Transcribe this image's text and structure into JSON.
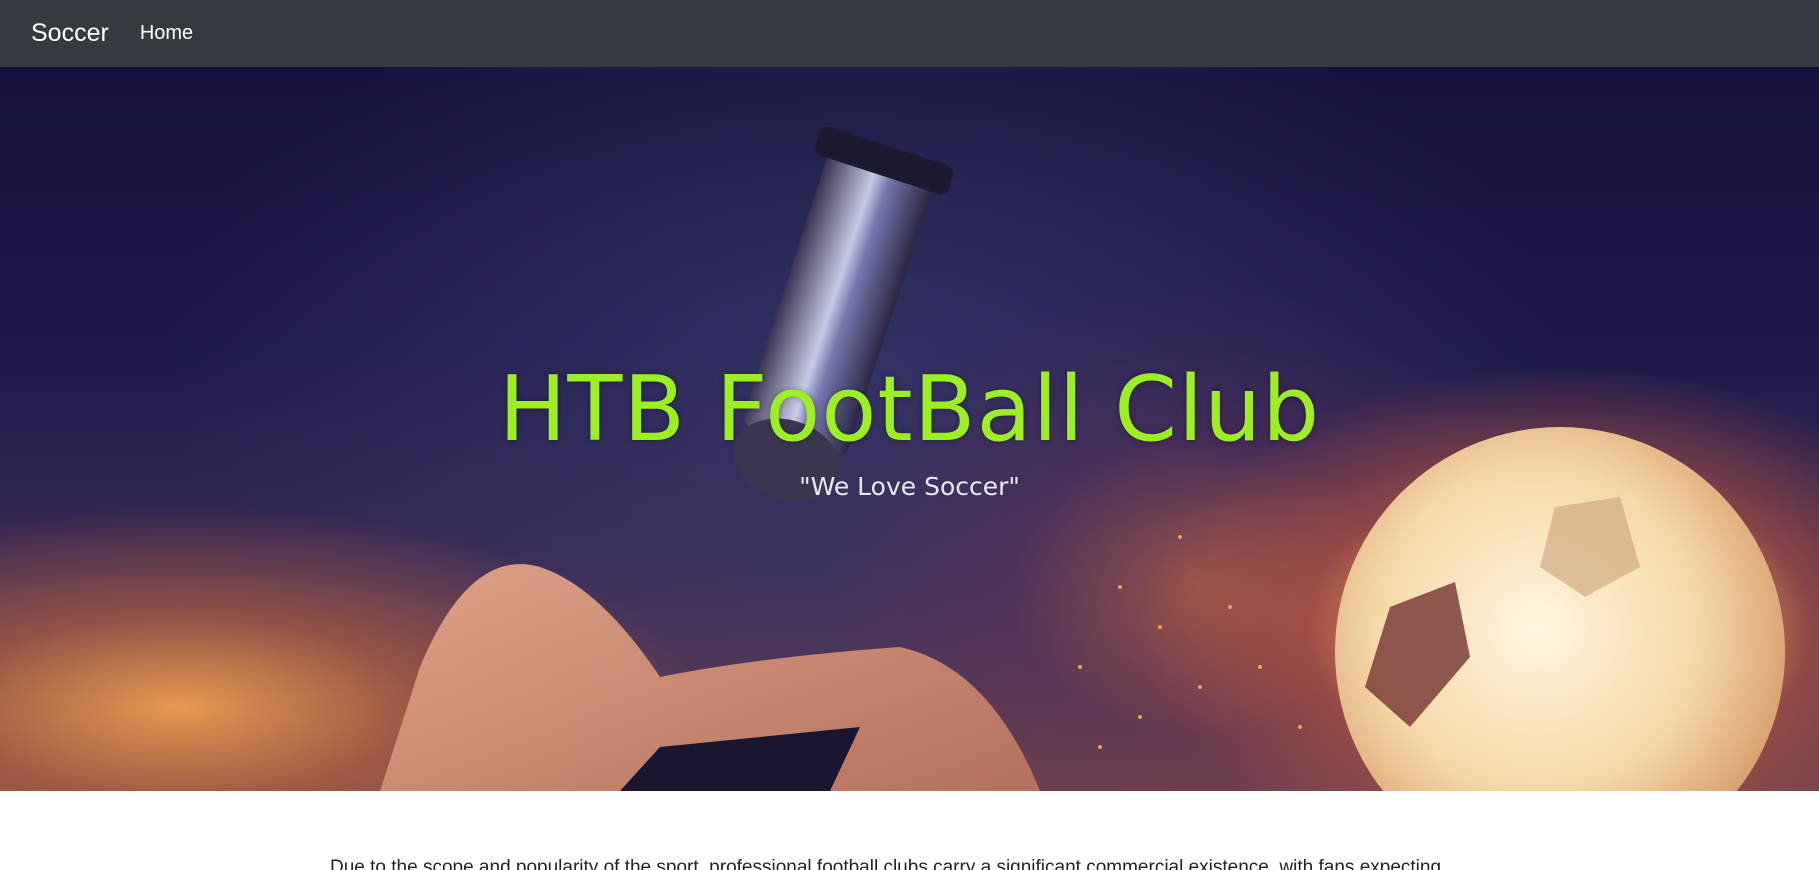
{
  "navbar": {
    "brand": "Soccer",
    "links": [
      {
        "label": "Home"
      }
    ]
  },
  "hero": {
    "title": "HTB FootBall Club",
    "tagline": "\"We Love Soccer\"",
    "title_color": "#9dee24",
    "background_image": "soccer cleat kicking flaming ball"
  },
  "content": {
    "intro_text": "Due to the scope and popularity of the sport, professional football clubs carry a significant commercial existence, with fans expecting personal"
  },
  "colors": {
    "navbar_bg": "#343a40",
    "accent": "#9dee24"
  }
}
